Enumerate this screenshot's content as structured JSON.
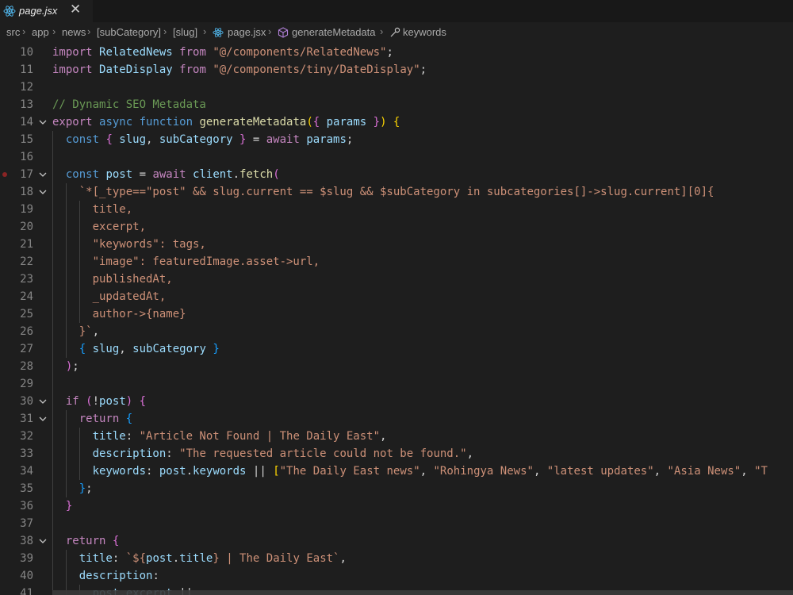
{
  "tab": {
    "label": "page.jsx",
    "close_glyph": "✕",
    "icon": "react-icon"
  },
  "breadcrumb": {
    "items": [
      "src",
      "app",
      "news",
      "[subCategory]",
      "[slug]",
      "page.jsx",
      "generateMetadata",
      "keywords"
    ],
    "separator": "›"
  },
  "lines": [
    {
      "n": "10",
      "tokens": [
        [
          "import ",
          "k-imp"
        ],
        [
          "RelatedNews ",
          "var"
        ],
        [
          "from ",
          "k-imp"
        ],
        [
          "\"@/components/RelatedNews\"",
          "str"
        ],
        [
          ";",
          "plain"
        ]
      ]
    },
    {
      "n": "11",
      "tokens": [
        [
          "import ",
          "k-imp"
        ],
        [
          "DateDisplay ",
          "var"
        ],
        [
          "from ",
          "k-imp"
        ],
        [
          "\"@/components/tiny/DateDisplay\"",
          "str"
        ],
        [
          ";",
          "plain"
        ]
      ]
    },
    {
      "n": "12",
      "tokens": []
    },
    {
      "n": "13",
      "tokens": [
        [
          "// Dynamic SEO Metadata",
          "cmt"
        ]
      ]
    },
    {
      "n": "14",
      "fold": true,
      "tokens": [
        [
          "export ",
          "k-imp"
        ],
        [
          "async ",
          "k"
        ],
        [
          "function ",
          "k"
        ],
        [
          "generateMetadata",
          "fn"
        ],
        [
          "(",
          "br1"
        ],
        [
          "{ ",
          "br2"
        ],
        [
          "params ",
          "var"
        ],
        [
          "}",
          "br2"
        ],
        [
          ") ",
          "br1"
        ],
        [
          "{",
          "br1"
        ]
      ]
    },
    {
      "n": "15",
      "tokens": [
        [
          "  const ",
          "k"
        ],
        [
          "{ ",
          "br2"
        ],
        [
          "slug",
          "var"
        ],
        [
          ", ",
          "plain"
        ],
        [
          "subCategory ",
          "var"
        ],
        [
          "} ",
          "br2"
        ],
        [
          "= ",
          "plain"
        ],
        [
          "await ",
          "k-imp"
        ],
        [
          "params",
          "var"
        ],
        [
          ";",
          "plain"
        ]
      ]
    },
    {
      "n": "16",
      "tokens": []
    },
    {
      "n": "17",
      "fold": true,
      "bp": true,
      "tokens": [
        [
          "  const ",
          "k"
        ],
        [
          "post ",
          "var"
        ],
        [
          "= ",
          "plain"
        ],
        [
          "await ",
          "k-imp"
        ],
        [
          "client",
          "var"
        ],
        [
          ".",
          "plain"
        ],
        [
          "fetch",
          "fn"
        ],
        [
          "(",
          "br2"
        ]
      ]
    },
    {
      "n": "18",
      "fold": true,
      "tokens": [
        [
          "    `*[_type==\"post\" && slug.current == $slug && $subCategory in subcategories[]->slug.current][0]{",
          "str"
        ]
      ]
    },
    {
      "n": "19",
      "tokens": [
        [
          "      title,",
          "str"
        ]
      ]
    },
    {
      "n": "20",
      "tokens": [
        [
          "      excerpt,",
          "str"
        ]
      ]
    },
    {
      "n": "21",
      "tokens": [
        [
          "      \"keywords\": tags,",
          "str"
        ]
      ]
    },
    {
      "n": "22",
      "tokens": [
        [
          "      \"image\": featuredImage.asset->url,",
          "str"
        ]
      ]
    },
    {
      "n": "23",
      "tokens": [
        [
          "      publishedAt,",
          "str"
        ]
      ]
    },
    {
      "n": "24",
      "tokens": [
        [
          "      _updatedAt,",
          "str"
        ]
      ]
    },
    {
      "n": "25",
      "tokens": [
        [
          "      author->{name}",
          "str"
        ]
      ]
    },
    {
      "n": "26",
      "tokens": [
        [
          "    }`",
          "str"
        ],
        [
          ",",
          "plain"
        ]
      ]
    },
    {
      "n": "27",
      "tokens": [
        [
          "    { ",
          "br3"
        ],
        [
          "slug",
          "var"
        ],
        [
          ", ",
          "plain"
        ],
        [
          "subCategory ",
          "var"
        ],
        [
          "}",
          "br3"
        ]
      ]
    },
    {
      "n": "28",
      "tokens": [
        [
          "  )",
          "br2"
        ],
        [
          ";",
          "plain"
        ]
      ]
    },
    {
      "n": "29",
      "tokens": []
    },
    {
      "n": "30",
      "fold": true,
      "tokens": [
        [
          "  if ",
          "k-imp"
        ],
        [
          "(",
          "br2"
        ],
        [
          "!",
          "plain"
        ],
        [
          "post",
          "var"
        ],
        [
          ") ",
          "br2"
        ],
        [
          "{",
          "br2"
        ]
      ]
    },
    {
      "n": "31",
      "fold": true,
      "tokens": [
        [
          "    return ",
          "k-imp"
        ],
        [
          "{",
          "br3"
        ]
      ]
    },
    {
      "n": "32",
      "tokens": [
        [
          "      title",
          "var"
        ],
        [
          ": ",
          "plain"
        ],
        [
          "\"Article Not Found | The Daily East\"",
          "str"
        ],
        [
          ",",
          "plain"
        ]
      ]
    },
    {
      "n": "33",
      "tokens": [
        [
          "      description",
          "var"
        ],
        [
          ": ",
          "plain"
        ],
        [
          "\"The requested article could not be found.\"",
          "str"
        ],
        [
          ",",
          "plain"
        ]
      ]
    },
    {
      "n": "34",
      "tokens": [
        [
          "      keywords",
          "var"
        ],
        [
          ": ",
          "plain"
        ],
        [
          "post",
          "var"
        ],
        [
          ".",
          "plain"
        ],
        [
          "keywords ",
          "var"
        ],
        [
          "|| ",
          "plain"
        ],
        [
          "[",
          "br1"
        ],
        [
          "\"The Daily East news\"",
          "str"
        ],
        [
          ", ",
          "plain"
        ],
        [
          "\"Rohingya News\"",
          "str"
        ],
        [
          ", ",
          "plain"
        ],
        [
          "\"latest updates\"",
          "str"
        ],
        [
          ", ",
          "plain"
        ],
        [
          "\"Asia News\"",
          "str"
        ],
        [
          ", ",
          "plain"
        ],
        [
          "\"T",
          "str"
        ]
      ]
    },
    {
      "n": "35",
      "tokens": [
        [
          "    }",
          "br3"
        ],
        [
          ";",
          "plain"
        ]
      ]
    },
    {
      "n": "36",
      "tokens": [
        [
          "  }",
          "br2"
        ]
      ]
    },
    {
      "n": "37",
      "tokens": []
    },
    {
      "n": "38",
      "fold": true,
      "tokens": [
        [
          "  return ",
          "k-imp"
        ],
        [
          "{",
          "br2"
        ]
      ]
    },
    {
      "n": "39",
      "tokens": [
        [
          "    title",
          "var"
        ],
        [
          ": ",
          "plain"
        ],
        [
          "`${",
          "str"
        ],
        [
          "post",
          "var"
        ],
        [
          ".",
          "plain"
        ],
        [
          "title",
          "var"
        ],
        [
          "}",
          "str"
        ],
        [
          " | The Daily East`",
          "str"
        ],
        [
          ",",
          "plain"
        ]
      ]
    },
    {
      "n": "40",
      "tokens": [
        [
          "    description",
          "var"
        ],
        [
          ":",
          "plain"
        ]
      ]
    },
    {
      "n": "41",
      "tokens": [
        [
          "      post",
          "var"
        ],
        [
          ".",
          "plain"
        ],
        [
          "excerpt ",
          "var"
        ],
        [
          "||",
          "plain"
        ]
      ]
    }
  ]
}
